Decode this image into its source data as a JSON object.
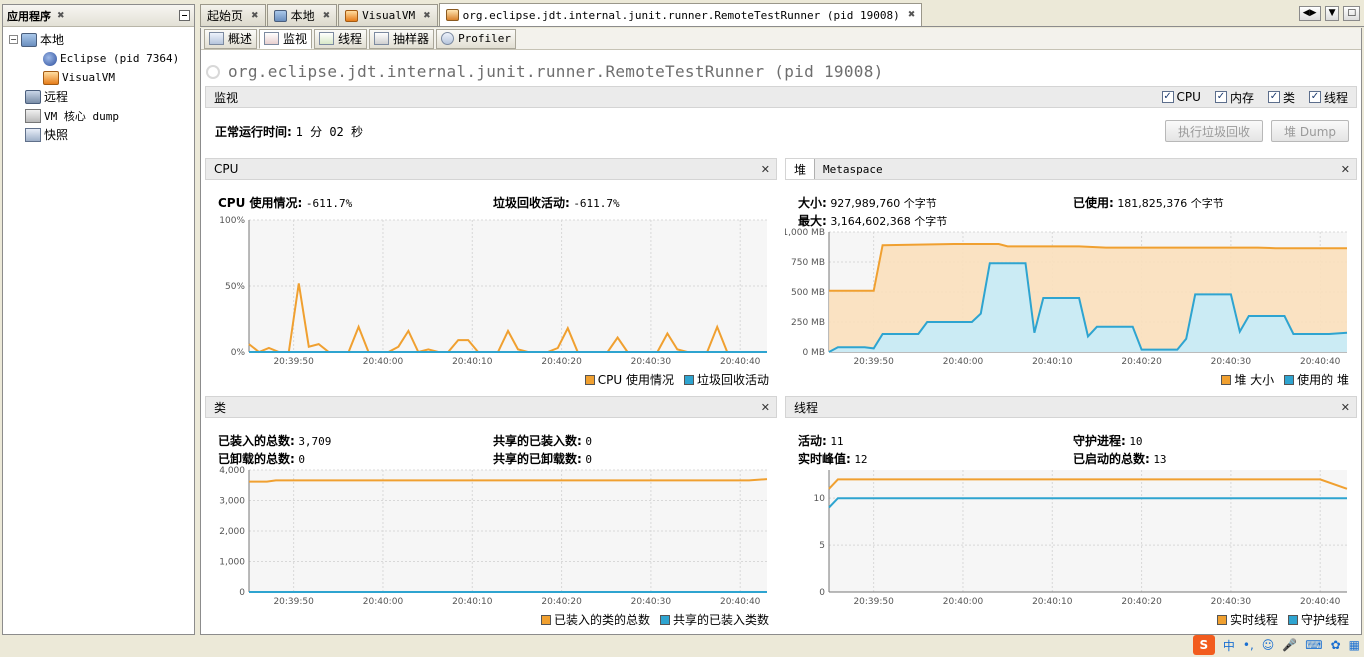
{
  "sidebar": {
    "title": "应用程序",
    "items": [
      {
        "label": "本地",
        "icon": "computer-icon"
      },
      {
        "label": "Eclipse (pid 7364)",
        "icon": "eclipse-icon"
      },
      {
        "label": "VisualVM",
        "icon": "visualvm-icon"
      },
      {
        "label": "远程",
        "icon": "remote-icon"
      },
      {
        "label": "VM 核心 dump",
        "icon": "core-dump-icon"
      },
      {
        "label": "快照",
        "icon": "snapshot-icon"
      }
    ]
  },
  "tabs": [
    {
      "label": "起始页"
    },
    {
      "label": "本地"
    },
    {
      "label": "VisualVM"
    },
    {
      "label": "org.eclipse.jdt.internal.junit.runner.RemoteTestRunner (pid 19008)"
    }
  ],
  "subtabs": [
    {
      "label": "概述"
    },
    {
      "label": "监视"
    },
    {
      "label": "线程"
    },
    {
      "label": "抽样器"
    },
    {
      "label": "Profiler"
    }
  ],
  "page_title": "org.eclipse.jdt.internal.junit.runner.RemoteTestRunner (pid 19008)",
  "monitor": {
    "header": "监视",
    "checks": [
      {
        "label": "CPU",
        "checked": true
      },
      {
        "label": "内存",
        "checked": true
      },
      {
        "label": "类",
        "checked": true
      },
      {
        "label": "线程",
        "checked": true
      }
    ],
    "uptime_label": "正常运行时间:",
    "uptime_value": "1 分 02 秒",
    "gc_button": "执行垃圾回收",
    "dump_button": "堆 Dump"
  },
  "cpu_panel": {
    "title": "CPU",
    "usage_label": "CPU 使用情况:",
    "usage_value": "-611.7%",
    "gc_label": "垃圾回收活动:",
    "gc_value": "-611.7%",
    "legend": [
      "CPU 使用情况",
      "垃圾回收活动"
    ]
  },
  "heap_panel": {
    "tab_heap": "堆",
    "tab_meta": "Metaspace",
    "size_label": "大小:",
    "size_value": "927,989,760 个字节",
    "max_label": "最大:",
    "max_value": "3,164,602,368 个字节",
    "used_label": "已使用:",
    "used_value": "181,825,376 个字节",
    "legend": [
      "堆 大小",
      "使用的 堆"
    ]
  },
  "class_panel": {
    "title": "类",
    "loaded_label": "已装入的总数:",
    "loaded_value": "3,709",
    "unloaded_label": "已卸载的总数:",
    "unloaded_value": "0",
    "shared_loaded_label": "共享的已装入数:",
    "shared_loaded_value": "0",
    "shared_unloaded_label": "共享的已卸载数:",
    "shared_unloaded_value": "0",
    "legend": [
      "已装入的类的总数",
      "共享的已装入类数"
    ]
  },
  "thread_panel": {
    "title": "线程",
    "live_label": "活动:",
    "live_value": "11",
    "peak_label": "实时峰值:",
    "peak_value": "12",
    "daemon_label": "守护进程:",
    "daemon_value": "10",
    "started_label": "已启动的总数:",
    "started_value": "13",
    "legend": [
      "实时线程",
      "守护线程"
    ]
  },
  "colors": {
    "orange": "#f0a030",
    "blue": "#2ea4d0"
  },
  "chart_data": [
    {
      "type": "line",
      "title": "CPU",
      "x": [
        "20:39:45",
        "20:39:46",
        "20:39:47",
        "20:39:48",
        "20:39:49",
        "20:39:50",
        "20:39:51",
        "20:39:52",
        "20:39:53",
        "20:39:54",
        "20:39:55",
        "20:39:56",
        "20:39:57",
        "20:39:58",
        "20:39:59",
        "20:40:00",
        "20:40:01",
        "20:40:02",
        "20:40:03",
        "20:40:04",
        "20:40:05",
        "20:40:06",
        "20:40:07",
        "20:40:08",
        "20:40:09",
        "20:40:10",
        "20:40:11",
        "20:40:12",
        "20:40:13",
        "20:40:14",
        "20:40:15",
        "20:40:16",
        "20:40:17",
        "20:40:18",
        "20:40:19",
        "20:40:20",
        "20:40:21",
        "20:40:22",
        "20:40:23",
        "20:40:24",
        "20:40:25",
        "20:40:26",
        "20:40:27",
        "20:40:28",
        "20:40:29",
        "20:40:30",
        "20:40:31",
        "20:40:32",
        "20:40:33",
        "20:40:34",
        "20:40:35",
        "20:40:36",
        "20:40:37"
      ],
      "series": [
        {
          "name": "CPU 使用情况",
          "values": [
            6,
            0,
            3,
            0,
            0,
            52,
            4,
            6,
            0,
            0,
            0,
            19,
            0,
            0,
            0,
            4,
            16,
            0,
            2,
            0,
            0,
            9,
            9,
            0,
            0,
            0,
            16,
            2,
            0,
            0,
            0,
            3,
            18,
            0,
            0,
            0,
            0,
            11,
            0,
            0,
            0,
            0,
            14,
            2,
            0,
            0,
            0,
            19,
            0,
            0,
            0,
            0,
            0
          ]
        },
        {
          "name": "垃圾回收活动",
          "values": [
            0,
            0,
            0,
            0,
            0,
            0,
            0,
            0,
            0,
            0,
            0,
            0,
            0,
            0,
            0,
            0,
            0,
            0,
            0,
            0,
            0,
            0,
            0,
            0,
            0,
            0,
            0,
            0,
            0,
            0,
            0,
            0,
            0,
            0,
            0,
            0,
            0,
            0,
            0,
            0,
            0,
            0,
            0,
            0,
            0,
            0,
            0,
            0,
            0,
            0,
            0,
            0,
            0
          ]
        }
      ],
      "yticks": [
        "0%",
        "50%",
        "100%"
      ],
      "ylim": [
        0,
        100
      ],
      "xticks": [
        "20:39:50",
        "20:40:00",
        "20:40:10",
        "20:40:20",
        "20:40:30",
        "20:40:40"
      ]
    },
    {
      "type": "area",
      "title": "堆",
      "series": [
        {
          "name": "堆 大小",
          "points": [
            [
              0,
              510
            ],
            [
              5,
              510
            ],
            [
              6,
              890
            ],
            [
              14,
              900
            ],
            [
              19,
              900
            ],
            [
              20,
              880
            ],
            [
              28,
              880
            ],
            [
              31,
              870
            ],
            [
              48,
              870
            ],
            [
              50,
              865
            ],
            [
              58,
              865
            ]
          ]
        },
        {
          "name": "使用的 堆",
          "points": [
            [
              0,
              0
            ],
            [
              1,
              40
            ],
            [
              4,
              40
            ],
            [
              5,
              30
            ],
            [
              6,
              150
            ],
            [
              10,
              150
            ],
            [
              11,
              250
            ],
            [
              16,
              250
            ],
            [
              17,
              320
            ],
            [
              18,
              740
            ],
            [
              22,
              740
            ],
            [
              23,
              160
            ],
            [
              24,
              450
            ],
            [
              28,
              450
            ],
            [
              29,
              130
            ],
            [
              30,
              210
            ],
            [
              34,
              210
            ],
            [
              35,
              20
            ],
            [
              39,
              20
            ],
            [
              40,
              110
            ],
            [
              41,
              480
            ],
            [
              45,
              480
            ],
            [
              46,
              170
            ],
            [
              47,
              300
            ],
            [
              51,
              300
            ],
            [
              52,
              150
            ],
            [
              56,
              150
            ],
            [
              58,
              160
            ]
          ]
        }
      ],
      "yticks": [
        "0 MB",
        "250 MB",
        "500 MB",
        "750 MB",
        "1,000 MB"
      ],
      "ylim": [
        0,
        1000
      ],
      "xticks": [
        "20:39:50",
        "20:40:00",
        "20:40:10",
        "20:40:20",
        "20:40:30",
        "20:40:40"
      ]
    },
    {
      "type": "line",
      "title": "类",
      "series": [
        {
          "name": "已装入的类的总数",
          "points": [
            [
              0,
              3620
            ],
            [
              2,
              3620
            ],
            [
              3,
              3660
            ],
            [
              56,
              3660
            ],
            [
              58,
              3700
            ]
          ]
        },
        {
          "name": "共享的已装入类数",
          "points": [
            [
              0,
              0
            ],
            [
              58,
              0
            ]
          ]
        }
      ],
      "yticks": [
        "0",
        "1,000",
        "2,000",
        "3,000",
        "4,000"
      ],
      "ylim": [
        0,
        4000
      ],
      "xticks": [
        "20:39:50",
        "20:40:00",
        "20:40:10",
        "20:40:20",
        "20:40:30",
        "20:40:40"
      ]
    },
    {
      "type": "line",
      "title": "线程",
      "series": [
        {
          "name": "实时线程",
          "points": [
            [
              0,
              11
            ],
            [
              1,
              12
            ],
            [
              55,
              12
            ],
            [
              58,
              11
            ]
          ]
        },
        {
          "name": "守护线程",
          "points": [
            [
              0,
              9
            ],
            [
              1,
              10
            ],
            [
              58,
              10
            ]
          ]
        }
      ],
      "yticks": [
        "0",
        "5",
        "10"
      ],
      "ylim": [
        0,
        13
      ],
      "xticks": [
        "20:39:50",
        "20:40:00",
        "20:40:10",
        "20:40:20",
        "20:40:30",
        "20:40:40"
      ]
    }
  ]
}
